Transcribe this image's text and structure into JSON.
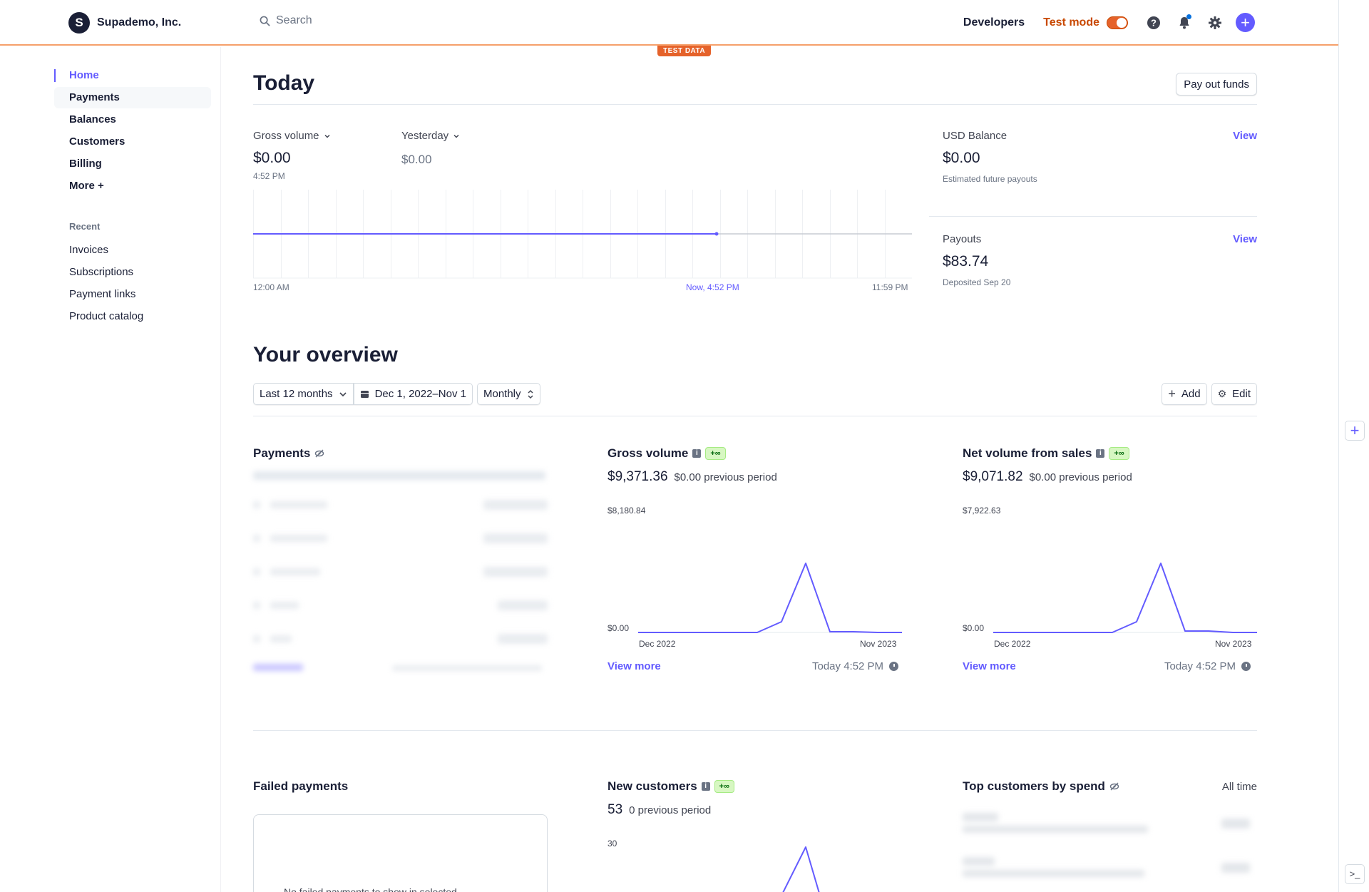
{
  "topbar": {
    "org_initial": "S",
    "org_name": "Supademo, Inc.",
    "search_placeholder": "Search",
    "developers": "Developers",
    "test_mode": "Test mode",
    "test_badge": "TEST DATA"
  },
  "sidebar": {
    "items": [
      {
        "label": "Home"
      },
      {
        "label": "Payments"
      },
      {
        "label": "Balances"
      },
      {
        "label": "Customers"
      },
      {
        "label": "Billing"
      },
      {
        "label": "More +"
      }
    ],
    "recent_label": "Recent",
    "recent": [
      {
        "label": "Invoices"
      },
      {
        "label": "Subscriptions"
      },
      {
        "label": "Payment links"
      },
      {
        "label": "Product catalog"
      }
    ]
  },
  "today": {
    "title": "Today",
    "payout_button": "Pay out funds",
    "gross_label": "Gross volume",
    "gross_value": "$0.00",
    "gross_time": "4:52 PM",
    "compare_label": "Yesterday",
    "compare_value": "$0.00",
    "axis_start": "12:00 AM",
    "axis_now": "Now, 4:52 PM",
    "axis_end": "11:59 PM",
    "usd_label": "USD Balance",
    "usd_value": "$0.00",
    "usd_sub": "Estimated future payouts",
    "payouts_label": "Payouts",
    "payouts_value": "$83.74",
    "payouts_sub": "Deposited Sep 20",
    "view": "View"
  },
  "overview": {
    "title": "Your overview",
    "range": "Last 12 months",
    "dates": "Dec 1, 2022–Nov 1",
    "interval": "Monthly",
    "add": "Add",
    "edit": "Edit"
  },
  "cards": {
    "payments_title": "Payments",
    "gross": {
      "title": "Gross volume",
      "badge": "+∞",
      "value": "$9,371.36",
      "prev": "$0.00 previous period",
      "ymax": "$8,180.84",
      "ymin": "$0.00",
      "x_start": "Dec 2022",
      "x_end": "Nov 2023",
      "view_more": "View more",
      "updated": "Today 4:52 PM"
    },
    "net": {
      "title": "Net volume from sales",
      "badge": "+∞",
      "value": "$9,071.82",
      "prev": "$0.00 previous period",
      "ymax": "$7,922.63",
      "ymin": "$0.00",
      "x_start": "Dec 2022",
      "x_end": "Nov 2023",
      "view_more": "View more",
      "updated": "Today 4:52 PM"
    },
    "failed_title": "Failed payments",
    "failed_msg": "No failed payments to show in selected",
    "new_customers": {
      "title": "New customers",
      "badge": "+∞",
      "value": "53",
      "prev": "0 previous period",
      "ymax": "30"
    },
    "top_customers_title": "Top customers by spend",
    "all_time": "All time"
  },
  "colors": {
    "accent": "#635bff",
    "test_orange": "#e5622a",
    "text": "#1a1f36"
  }
}
